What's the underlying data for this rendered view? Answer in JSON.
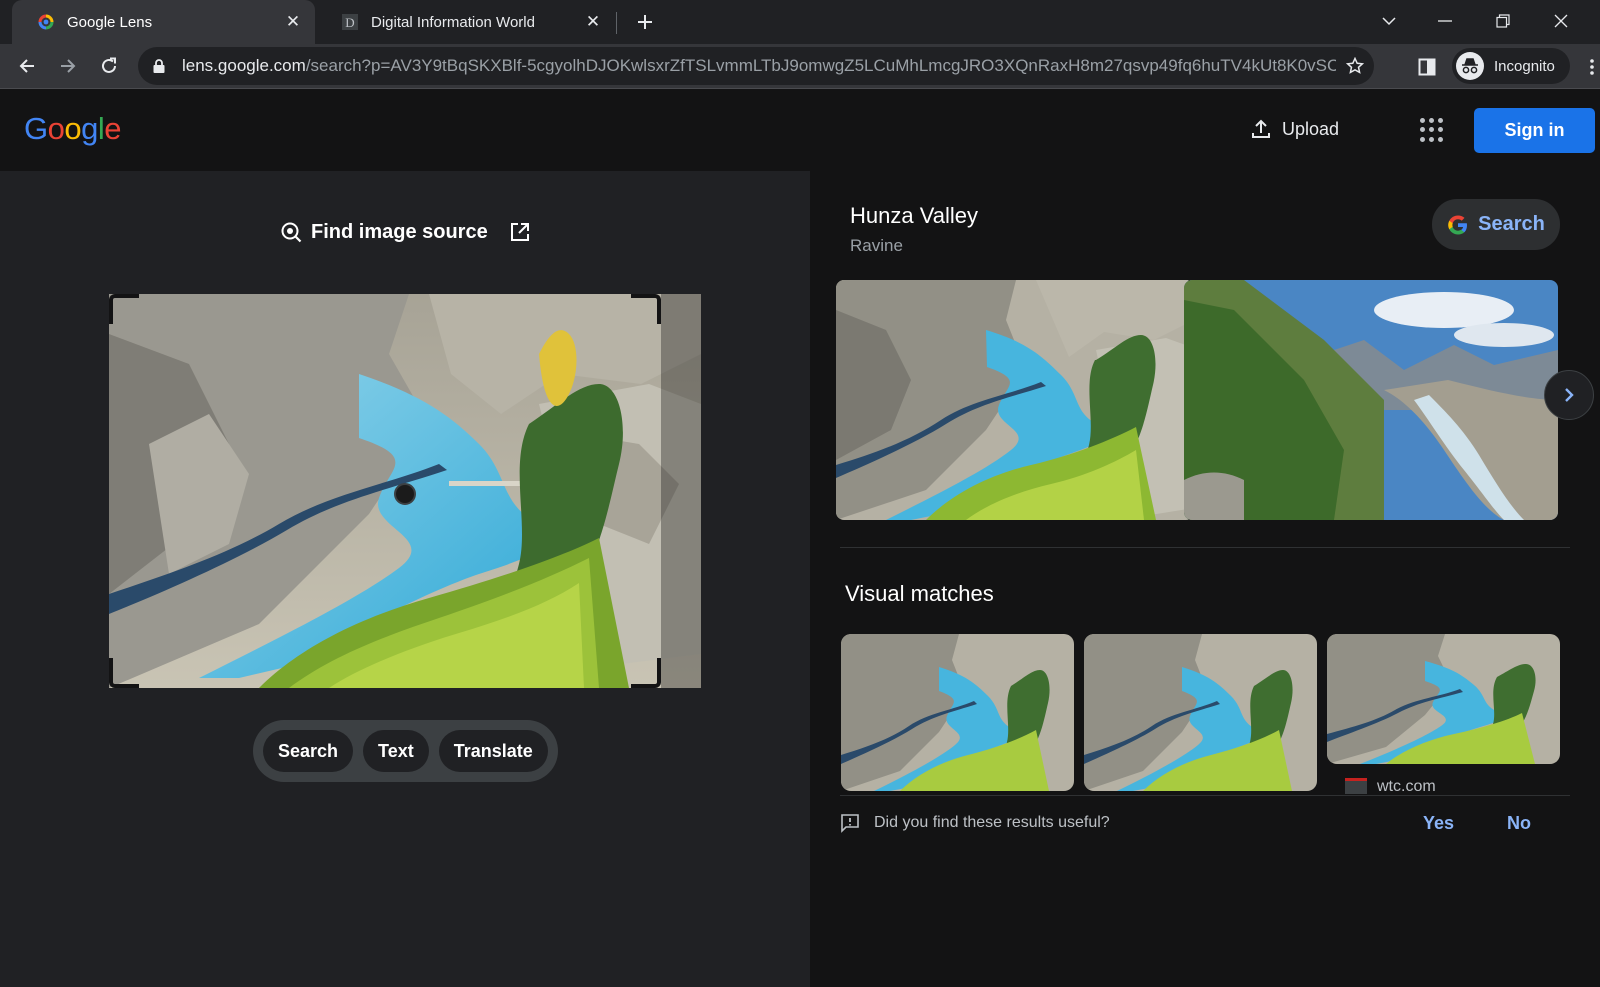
{
  "browser": {
    "tabs": [
      {
        "title": "Google Lens",
        "active": true
      },
      {
        "title": "Digital Information World",
        "active": false
      }
    ],
    "url_host": "lens.google.com",
    "url_path": "/search?p=AV3Y9tBqSKXBlf-5cgyolhDJOKwlsxrZfTSLvmmLTbJ9omwgZ5LCuMhLmcgJRO3XQnRaxH8m27qsvp49fq6huTV4kUt8K0vSC...",
    "profile_label": "Incognito"
  },
  "lens_header": {
    "logo": [
      "G",
      "o",
      "o",
      "g",
      "l",
      "e"
    ],
    "logo_colors": [
      "#4285f4",
      "#ea4335",
      "#fbbc05",
      "#4285f4",
      "#34a853",
      "#ea4335"
    ],
    "upload_label": "Upload",
    "signin_label": "Sign in"
  },
  "left": {
    "find_source_label": "Find image source",
    "chips": [
      "Search",
      "Text",
      "Translate"
    ]
  },
  "right": {
    "entity_title": "Hunza Valley",
    "entity_subtitle": "Ravine",
    "entity_search_label": "Search",
    "visual_matches_title": "Visual matches",
    "match_source": "wtc.com",
    "feedback_question": "Did you find these results useful?",
    "feedback_yes": "Yes",
    "feedback_no": "No"
  },
  "colors": {
    "accent": "#1a73e8",
    "link": "#8ab4f8",
    "panel_dark": "#131314",
    "panel_mid": "#202124"
  }
}
